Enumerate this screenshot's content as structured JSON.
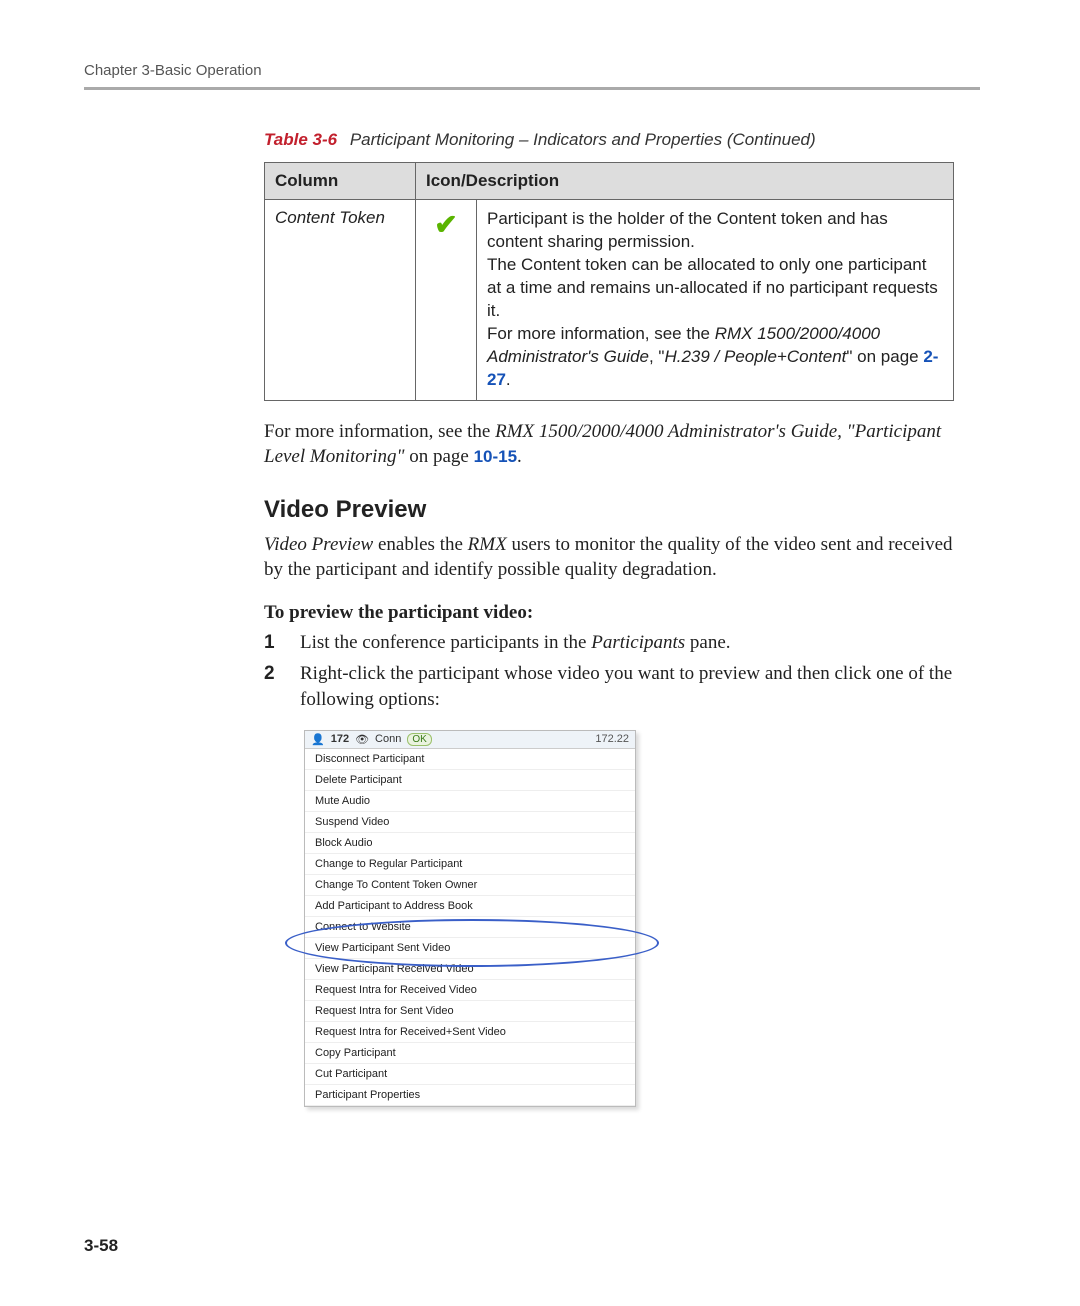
{
  "header": {
    "chapter": "Chapter 3-Basic Operation"
  },
  "caption": {
    "label": "Table 3-6",
    "text": "Participant Monitoring – Indicators and Properties (Continued)"
  },
  "table": {
    "th0": "Column",
    "th1": "Icon/Description",
    "row": {
      "col0": "Content Token",
      "desc1": "Participant is the holder of the Content token and has content sharing permission.",
      "desc2": "The Content token can be allocated to only one participant at a time and remains un-allocated if no participant requests it.",
      "desc3a": "For more information, see the ",
      "desc3b": "RMX 1500/2000/4000 Administrator's Guide",
      "desc3c": ", \"",
      "desc3d": "H.239 / People+Content",
      "desc3e": "\" on page ",
      "desc3link": "2-27",
      "desc3end": "."
    }
  },
  "p1": {
    "a": "For more information, see the ",
    "b": "RMX 1500/2000/4000 Administrator's Guide, \"Participant Level Monitoring\"",
    "c": " on page ",
    "link": "10-15",
    "d": "."
  },
  "section": "Video Preview",
  "p2": {
    "a": "Video Preview",
    "b": " enables the ",
    "c": "RMX",
    "d": " users to monitor the quality of the video sent and received by the participant and identify possible quality degradation."
  },
  "lead": "To preview the participant video:",
  "steps": {
    "s1": {
      "n": "1",
      "a": "List the conference participants in the ",
      "b": "Participants",
      "c": " pane."
    },
    "s2": {
      "n": "2",
      "a": "Right-click the participant whose video you want to preview and then click one of the following options:"
    }
  },
  "ctx": {
    "row": "172",
    "conn": "Conn",
    "ok": "OK",
    "ip": "172.22",
    "items": [
      "Disconnect Participant",
      "Delete Participant",
      "Mute Audio",
      "Suspend Video",
      "Block Audio",
      "Change to Regular Participant",
      "Change To Content Token Owner",
      "Add Participant to Address Book",
      "Connect to Website",
      "View Participant Sent Video",
      "View Participant Received Video",
      "Request Intra for Received Video",
      "Request Intra for Sent Video",
      "Request Intra for Received+Sent Video",
      "Copy Participant",
      "Cut Participant",
      "Participant Properties"
    ]
  },
  "footer": {
    "page": "3-58"
  }
}
